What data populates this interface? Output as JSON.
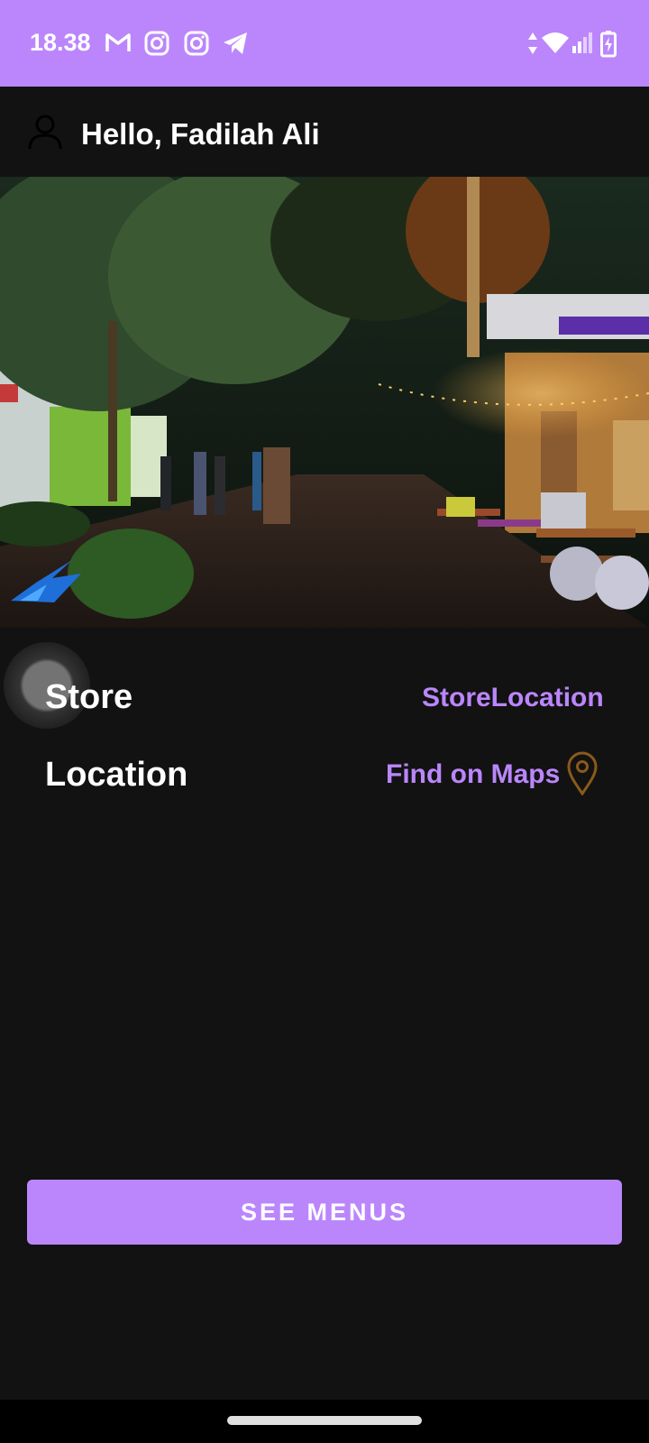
{
  "status_bar": {
    "time": "18.38",
    "icons": [
      "gmail-icon",
      "instagram-icon",
      "instagram-icon",
      "telegram-icon",
      "data-arrows-icon",
      "wifi-icon",
      "signal-icon",
      "battery-charging-icon"
    ],
    "background": "#bb86fc"
  },
  "header": {
    "greeting": "Hello, Fadilah Ali",
    "avatar_icon": "user-icon"
  },
  "hero": {
    "image": "night-street-cafe-photo",
    "logo": "app-logo"
  },
  "store_info": {
    "store_label": "Store",
    "store_value": "StoreLocation",
    "location_label": "Location",
    "location_value": "Find on Maps",
    "location_icon": "map-pin-icon"
  },
  "actions": {
    "see_menus_label": "SEE MENUS"
  },
  "colors": {
    "accent": "#bb86fc",
    "background": "#121212",
    "pin": "#8a5a1a"
  }
}
